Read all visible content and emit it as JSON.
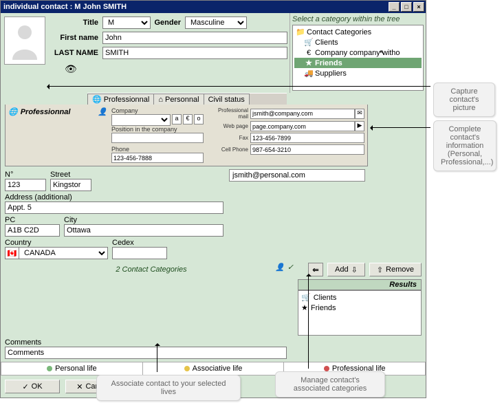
{
  "titlebar": "individual contact : M John SMITH",
  "identity": {
    "title_label": "Title",
    "title_value": "M",
    "gender_label": "Gender",
    "gender_value": "Masculine",
    "firstname_label": "First name",
    "firstname_value": "John",
    "lastname_label": "LAST NAME",
    "lastname_value": "SMITH"
  },
  "tree": {
    "prompt": "Select a category within the tree",
    "root": "Contact Categories",
    "items": [
      {
        "icon": "cart",
        "label": "Clients"
      },
      {
        "icon": "euro",
        "label": "Company company witho"
      },
      {
        "icon": "star",
        "label": "Friends",
        "selected": true
      },
      {
        "icon": "truck",
        "label": "Suppliers"
      }
    ]
  },
  "tabs": {
    "t0": "Professionnal",
    "t1": "Personnal",
    "t2": "Civil status"
  },
  "prof": {
    "header": "Professionnal",
    "company_label": "Company",
    "company_value": "",
    "position_label": "Position in the company",
    "position_value": "",
    "phone_label": "Phone",
    "phone_value": "123-456-7888",
    "email_label": "Professional mail",
    "email_value": "jsmith@company.com",
    "web_label": "Web page",
    "web_value": "page.company.com",
    "fax_label": "Fax",
    "fax_value": "123-456-7899",
    "cell_label": "Cell Phone",
    "cell_value": "987-654-3210"
  },
  "address": {
    "num_label": "N°",
    "num_value": "123",
    "street_label": "Street",
    "street_value": "Kingstor",
    "additional_label": "Address (additional)",
    "additional_value": "Appt. 5",
    "pc_label": "PC",
    "pc_value": "A1B C2D",
    "city_label": "City",
    "city_value": "Ottawa",
    "country_label": "Country",
    "country_value": "CANADA",
    "cedex_label": "Cedex",
    "cedex_value": ""
  },
  "personal_email": "jsmith@personal.com",
  "categories": {
    "count_text": "2 Contact Categories",
    "add_label": "Add",
    "remove_label": "Remove",
    "results_label": "Results",
    "associated": [
      {
        "icon": "cart",
        "label": "Clients"
      },
      {
        "icon": "star",
        "label": "Friends"
      }
    ]
  },
  "comments": {
    "label": "Comments",
    "value": "Comments"
  },
  "lives": {
    "personal": "Personal life",
    "associative": "Associative life",
    "professional": "Professional life"
  },
  "buttons": {
    "ok": "OK",
    "cancel": "Cancel"
  },
  "callouts": {
    "picture": "Capture contact's picture",
    "info": "Complete contact's information (Personal, Professional,...)",
    "lives": "Associate contact to your selected lives",
    "categories": "Manage contact's associated categories"
  }
}
